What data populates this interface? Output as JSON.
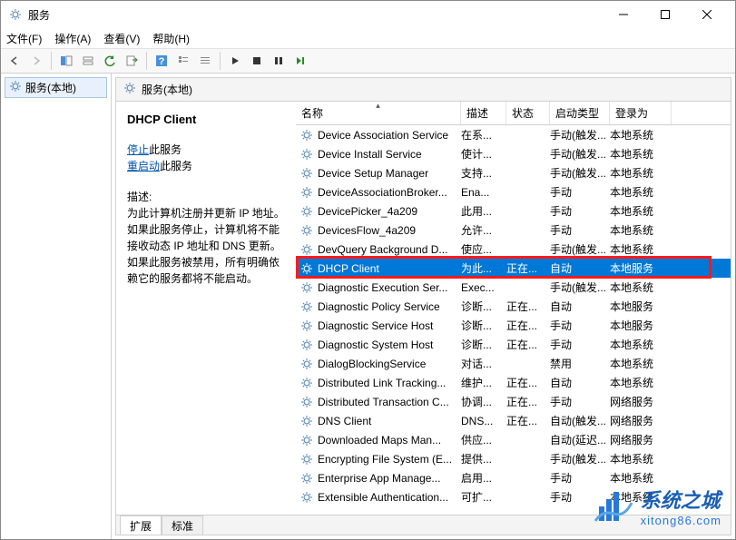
{
  "window": {
    "title": "服务"
  },
  "menu": {
    "file": "文件(F)",
    "action": "操作(A)",
    "view": "查看(V)",
    "help": "帮助(H)"
  },
  "leftpane": {
    "root": "服务(本地)"
  },
  "rightheader": {
    "title": "服务(本地)"
  },
  "detail": {
    "service_name": "DHCP Client",
    "stop_link": "停止",
    "stop_suffix": "此服务",
    "restart_link": "重启动",
    "restart_suffix": "此服务",
    "desc_label": "描述:",
    "desc_text": "为此计算机注册并更新 IP 地址。如果此服务停止，计算机将不能接收动态 IP 地址和 DNS 更新。如果此服务被禁用，所有明确依赖它的服务都将不能启动。"
  },
  "columns": {
    "name": "名称",
    "desc": "描述",
    "status": "状态",
    "startup": "启动类型",
    "logon": "登录为"
  },
  "rows": [
    {
      "name": "Device Association Service",
      "desc": "在系...",
      "status": "",
      "startup": "手动(触发...",
      "logon": "本地系统"
    },
    {
      "name": "Device Install Service",
      "desc": "使计...",
      "status": "",
      "startup": "手动(触发...",
      "logon": "本地系统"
    },
    {
      "name": "Device Setup Manager",
      "desc": "支持...",
      "status": "",
      "startup": "手动(触发...",
      "logon": "本地系统"
    },
    {
      "name": "DeviceAssociationBroker...",
      "desc": "Ena...",
      "status": "",
      "startup": "手动",
      "logon": "本地系统"
    },
    {
      "name": "DevicePicker_4a209",
      "desc": "此用...",
      "status": "",
      "startup": "手动",
      "logon": "本地系统"
    },
    {
      "name": "DevicesFlow_4a209",
      "desc": "允许...",
      "status": "",
      "startup": "手动",
      "logon": "本地系统"
    },
    {
      "name": "DevQuery Background D...",
      "desc": "使应...",
      "status": "",
      "startup": "手动(触发...",
      "logon": "本地系统"
    },
    {
      "name": "DHCP Client",
      "desc": "为此...",
      "status": "正在...",
      "startup": "自动",
      "logon": "本地服务",
      "selected": true
    },
    {
      "name": "Diagnostic Execution Ser...",
      "desc": "Exec...",
      "status": "",
      "startup": "手动(触发...",
      "logon": "本地系统"
    },
    {
      "name": "Diagnostic Policy Service",
      "desc": "诊断...",
      "status": "正在...",
      "startup": "自动",
      "logon": "本地服务"
    },
    {
      "name": "Diagnostic Service Host",
      "desc": "诊断...",
      "status": "正在...",
      "startup": "手动",
      "logon": "本地服务"
    },
    {
      "name": "Diagnostic System Host",
      "desc": "诊断...",
      "status": "正在...",
      "startup": "手动",
      "logon": "本地系统"
    },
    {
      "name": "DialogBlockingService",
      "desc": "对话...",
      "status": "",
      "startup": "禁用",
      "logon": "本地系统"
    },
    {
      "name": "Distributed Link Tracking...",
      "desc": "维护...",
      "status": "正在...",
      "startup": "自动",
      "logon": "本地系统"
    },
    {
      "name": "Distributed Transaction C...",
      "desc": "协调...",
      "status": "正在...",
      "startup": "手动",
      "logon": "网络服务"
    },
    {
      "name": "DNS Client",
      "desc": "DNS...",
      "status": "正在...",
      "startup": "自动(触发...",
      "logon": "网络服务"
    },
    {
      "name": "Downloaded Maps Man...",
      "desc": "供应...",
      "status": "",
      "startup": "自动(延迟...",
      "logon": "网络服务"
    },
    {
      "name": "Encrypting File System (E...",
      "desc": "提供...",
      "status": "",
      "startup": "手动(触发...",
      "logon": "本地系统"
    },
    {
      "name": "Enterprise App Manage...",
      "desc": "启用...",
      "status": "",
      "startup": "手动",
      "logon": "本地系统"
    },
    {
      "name": "Extensible Authentication...",
      "desc": "可扩...",
      "status": "",
      "startup": "手动",
      "logon": "本地系统"
    }
  ],
  "tabs": {
    "extended": "扩展",
    "standard": "标准"
  },
  "watermark": {
    "line1": "系统之城",
    "line2": "xitong86.com"
  }
}
